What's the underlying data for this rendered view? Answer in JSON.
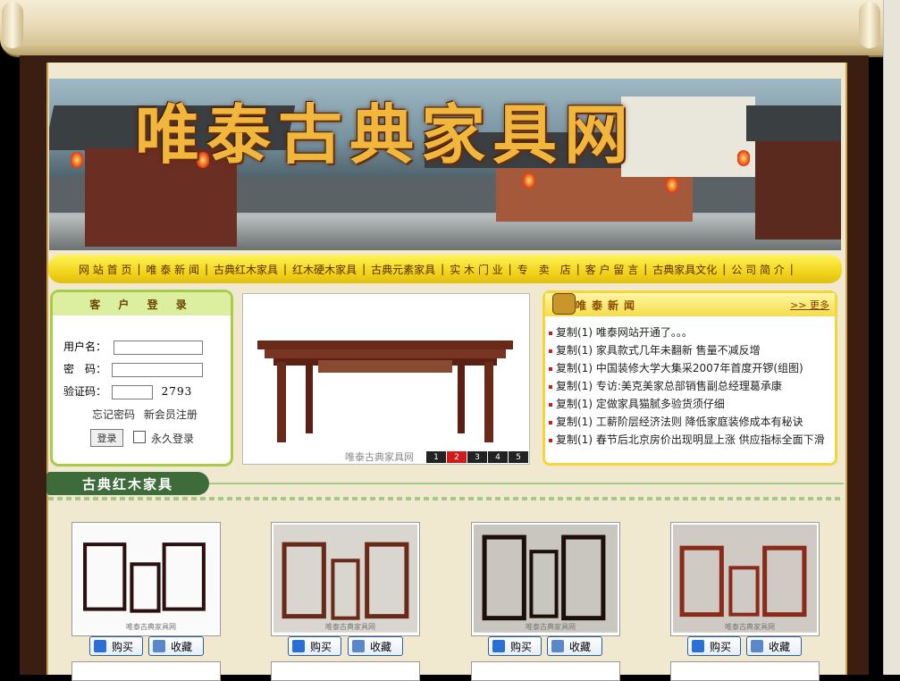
{
  "site": {
    "title": "唯泰古典家具网"
  },
  "nav": {
    "items": [
      "网 站 首 页",
      "唯 泰 新 闻",
      "古典红木家具",
      "红木硬木家具",
      "古典元素家具",
      "实 木 门 业",
      "专　卖　店",
      "客 户 留 言",
      "古典家具文化",
      "公 司 简 介"
    ]
  },
  "login": {
    "title": "客 户 登 录",
    "username_label": "用户名：",
    "password_label": "密　码：",
    "captcha_label": "验证码：",
    "captcha_value": "2793",
    "forgot": "忘记密码",
    "register": "新会员注册",
    "submit": "登录",
    "remember": "永久登录"
  },
  "slideshow": {
    "watermark": "唯泰古典家具网",
    "pages": [
      "1",
      "2",
      "3",
      "4",
      "5"
    ],
    "active": "2"
  },
  "news": {
    "title": "唯泰新闻",
    "more": ">> 更多",
    "items": [
      "复制(1) 唯泰网站开通了。。。",
      "复制(1) 家具款式几年未翻新 售量不减反增",
      "复制(1) 中国装修大学大集采2007年首度开锣(组图)",
      "复制(1) 专访:美克美家总部销售副总经理葛承康",
      "复制(1) 定做家具猫腻多验货须仔细",
      "复制(1) 工薪阶层经济法则 降低家庭装修成本有秘诀",
      "复制(1) 春节后北京房价出现明显上涨 供应指标全面下滑"
    ]
  },
  "section": {
    "title": "古典红木家具"
  },
  "products": {
    "buy_label": "购买",
    "fav_label": "收藏",
    "watermark": "唯泰古典家具网"
  },
  "colors": {
    "frame": "#3a1e12",
    "nav_bg": "#f2d51c",
    "login_border": "#a7cc4a",
    "news_border": "#f2d63b",
    "accent_red": "#d01b1b"
  }
}
